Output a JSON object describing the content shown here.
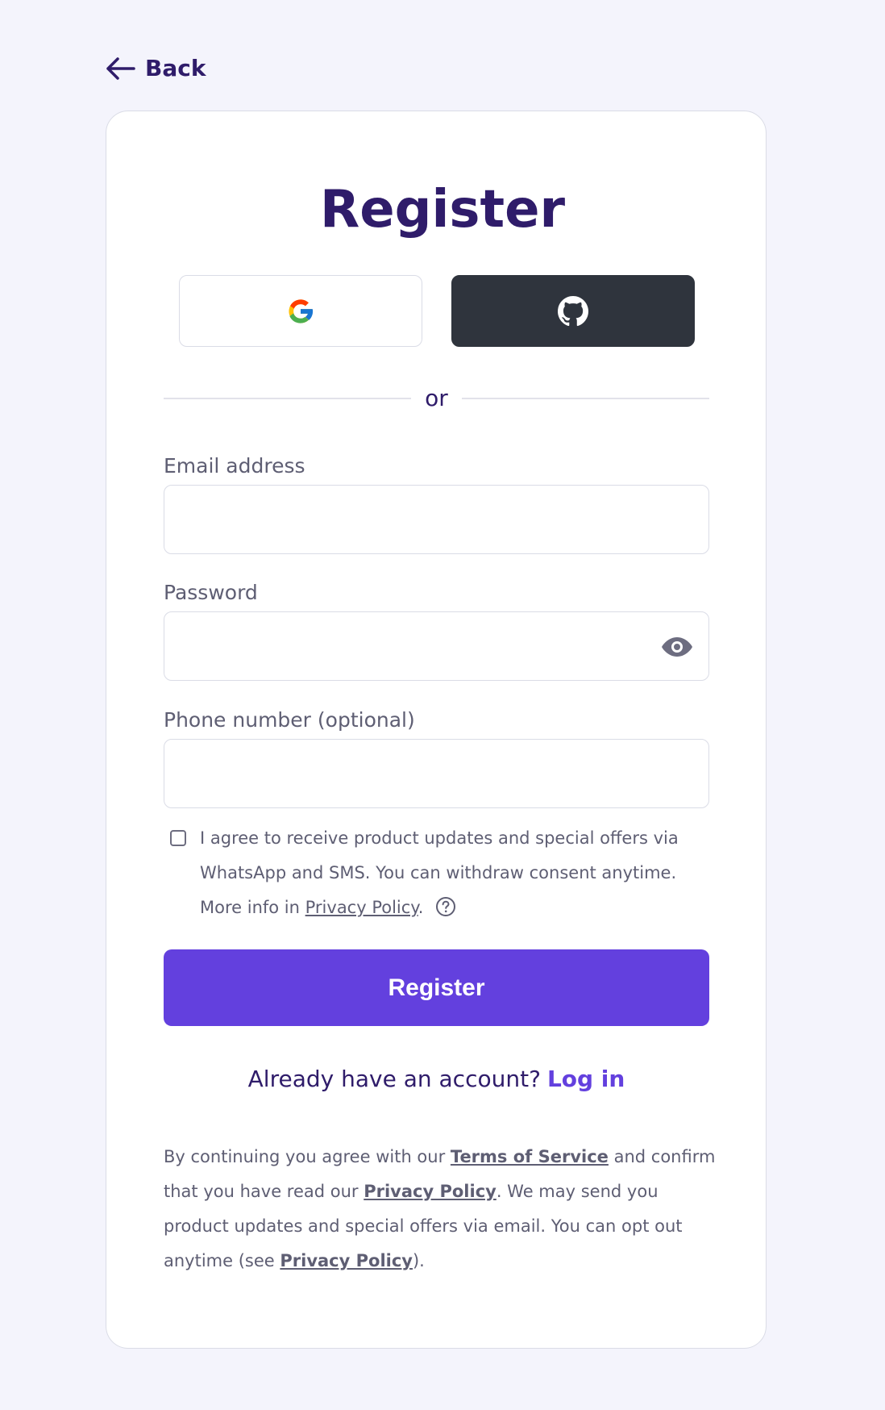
{
  "nav": {
    "back_label": "Back"
  },
  "form": {
    "title": "Register",
    "divider": "or",
    "email": {
      "label": "Email address",
      "value": "",
      "placeholder": ""
    },
    "password": {
      "label": "Password",
      "value": "",
      "placeholder": ""
    },
    "phone": {
      "label": "Phone number (optional)",
      "value": "",
      "placeholder": ""
    },
    "consent": {
      "checked": false,
      "text_before": "I agree to receive product updates and special offers via WhatsApp and SMS. You can withdraw consent anytime. More info in ",
      "link": "Privacy Policy",
      "text_after": "."
    },
    "submit_label": "Register",
    "login_prompt": "Already have an account?",
    "login_link": "Log in",
    "legal": {
      "part1": "By continuing you agree with our ",
      "terms_link": "Terms of Service",
      "part2": " and confirm that you have read our ",
      "privacy_link_1": "Privacy Policy",
      "part3": ". We may send you product updates and special offers via email. You can opt out anytime (see ",
      "privacy_link_2": "Privacy Policy",
      "part4": ")."
    }
  },
  "icons": {
    "back": "arrow-left-icon",
    "google": "google-icon",
    "github": "github-icon",
    "password_toggle": "eye-icon",
    "help": "question-circle-icon"
  },
  "colors": {
    "background": "#f4f4fc",
    "primary": "#6340de",
    "heading": "#2f1c6a",
    "github_button": "#2f343d",
    "muted_text": "#5e5e73"
  }
}
